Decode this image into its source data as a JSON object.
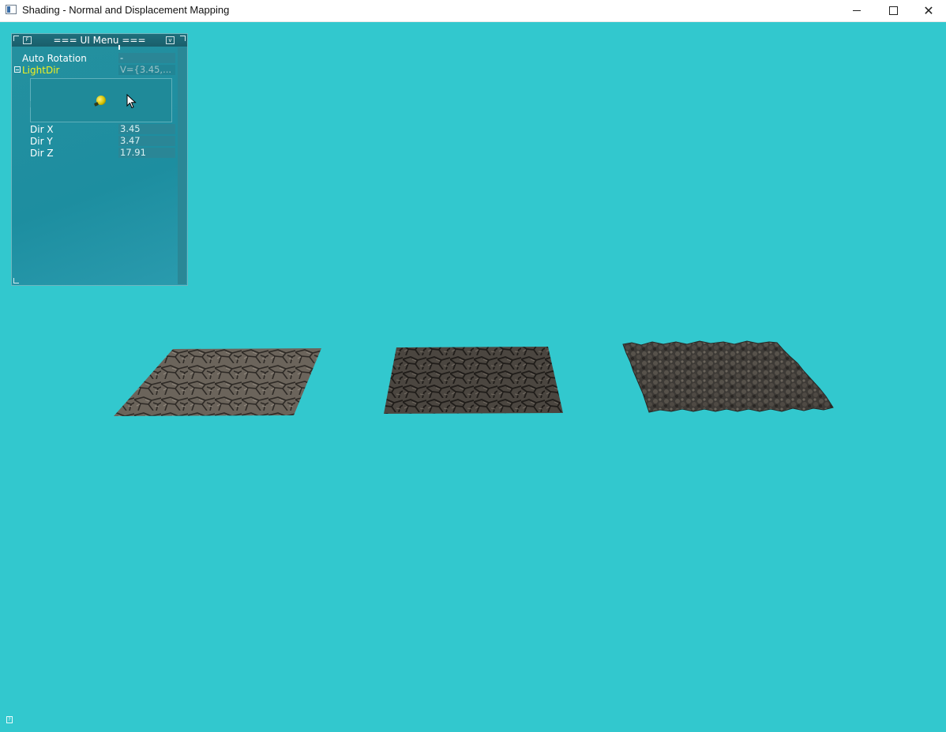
{
  "window": {
    "title": "Shading - Normal and Displacement Mapping",
    "controls": {
      "minimize": "minimize-icon",
      "maximize": "maximize-icon",
      "close": "close-icon",
      "close_glyph": "✕"
    }
  },
  "scene": {
    "background_color": "#32c8ce",
    "planes": [
      "textured-stone-plane",
      "normal-mapped-stone-plane",
      "displacement-mapped-stone-plane"
    ]
  },
  "ui_menu": {
    "title": "=== UI Menu ===",
    "header_left_glyph": "F",
    "header_right_glyph": "v",
    "rows": {
      "auto_rotation": {
        "label": "Auto Rotation",
        "value": "-"
      },
      "light_dir": {
        "label": "LightDir",
        "value": "V={3.45,..."
      },
      "dir_x": {
        "label": "Dir X",
        "value": "3.45"
      },
      "dir_y": {
        "label": "Dir Y",
        "value": "3.47"
      },
      "dir_z": {
        "label": "Dir Z",
        "value": "17.91"
      }
    },
    "label_color": "#ffffff",
    "group_label_color": "#f0f020"
  },
  "help_glyph": "?"
}
